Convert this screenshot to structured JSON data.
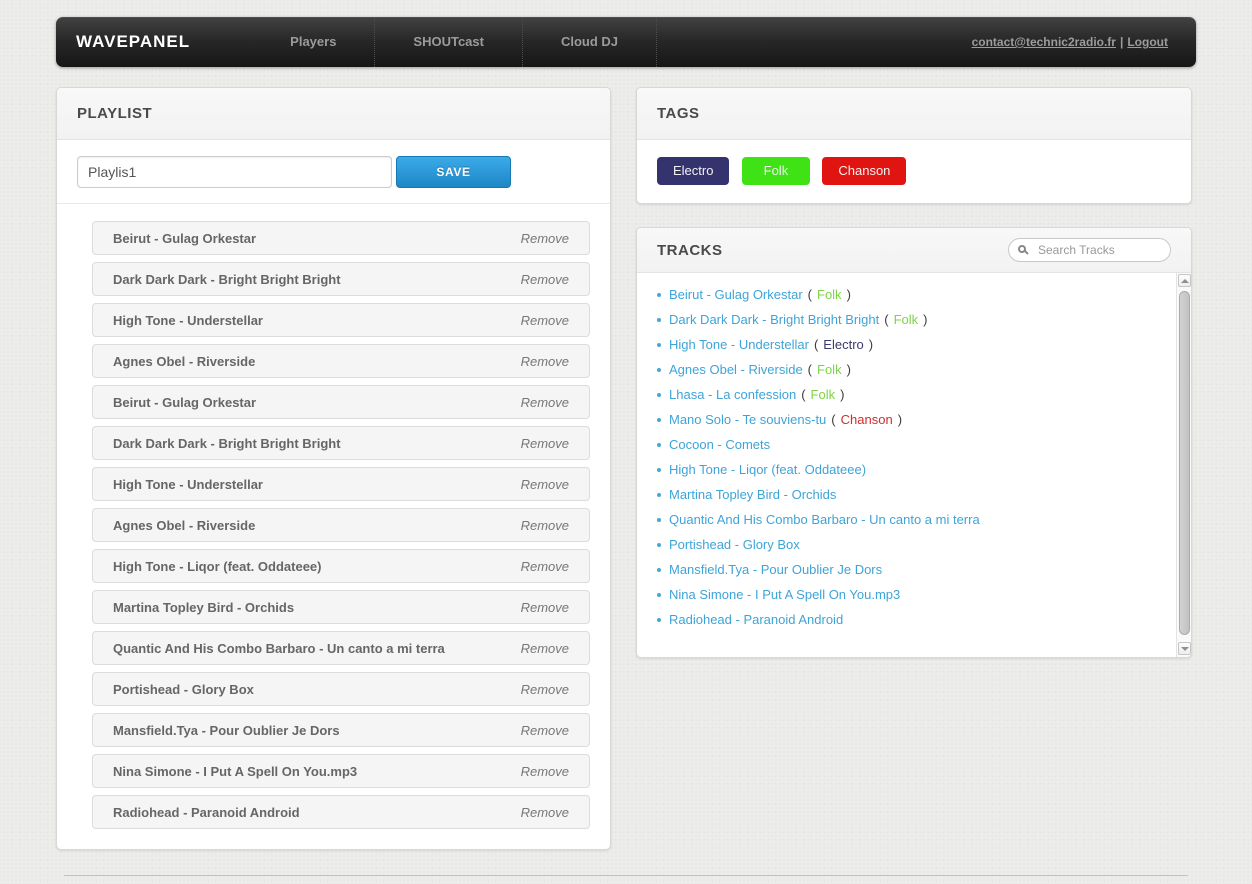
{
  "header": {
    "brand": "WAVEPANEL",
    "nav_items": [
      {
        "label": "Players"
      },
      {
        "label": "SHOUTcast"
      },
      {
        "label": "Cloud DJ"
      }
    ],
    "account_email": "contact@technic2radio.fr",
    "account_separator": "|",
    "logout_label": "Logout"
  },
  "playlist": {
    "title": "PLAYLIST",
    "name_value": "Playlis1",
    "save_label": "SAVE",
    "remove_label": "Remove",
    "items": [
      "Beirut - Gulag Orkestar",
      "Dark Dark Dark - Bright Bright Bright",
      "High Tone - Understellar",
      "Agnes Obel - Riverside",
      "Beirut - Gulag Orkestar",
      "Dark Dark Dark - Bright Bright Bright",
      "High Tone - Understellar",
      "Agnes Obel - Riverside",
      "High Tone - Liqor (feat. Oddateee)",
      "Martina Topley Bird - Orchids",
      "Quantic And His Combo Barbaro - Un canto a mi terra",
      "Portishead - Glory Box",
      "Mansfield.Tya - Pour Oublier Je Dors",
      "Nina Simone - I Put A Spell On You.mp3",
      "Radiohead - Paranoid Android"
    ]
  },
  "tags": {
    "title": "TAGS",
    "items": [
      {
        "label": "Electro",
        "color": "#35336E"
      },
      {
        "label": "Folk",
        "color": "#3FE215"
      },
      {
        "label": "Chanson",
        "color": "#E01512"
      }
    ]
  },
  "tracks": {
    "title": "TRACKS",
    "search_placeholder": "Search Tracks",
    "open_paren": "(",
    "close_paren": ")",
    "items": [
      {
        "title": "Beirut - Gulag Orkestar",
        "tag": "Folk",
        "tag_color": "#7ED348"
      },
      {
        "title": "Dark Dark Dark - Bright Bright Bright",
        "tag": "Folk",
        "tag_color": "#7ED348"
      },
      {
        "title": "High Tone - Understellar",
        "tag": "Electro",
        "tag_color": "#3A3A6E"
      },
      {
        "title": "Agnes Obel - Riverside",
        "tag": "Folk",
        "tag_color": "#7ED348"
      },
      {
        "title": "Lhasa - La confession",
        "tag": "Folk",
        "tag_color": "#7ED348"
      },
      {
        "title": "Mano Solo - Te souviens-tu",
        "tag": "Chanson",
        "tag_color": "#CE2F2C"
      },
      {
        "title": "Cocoon - Comets"
      },
      {
        "title": "High Tone - Liqor (feat. Oddateee)"
      },
      {
        "title": "Martina Topley Bird - Orchids"
      },
      {
        "title": "Quantic And His Combo Barbaro - Un canto a mi terra"
      },
      {
        "title": "Portishead - Glory Box"
      },
      {
        "title": "Mansfield.Tya - Pour Oublier Je Dors"
      },
      {
        "title": "Nina Simone - I Put A Spell On You.mp3"
      },
      {
        "title": "Radiohead - Paranoid Android"
      }
    ]
  },
  "colors": {
    "accent_blue": "#2FA4E7",
    "link_blue": "#3EA4D7"
  }
}
